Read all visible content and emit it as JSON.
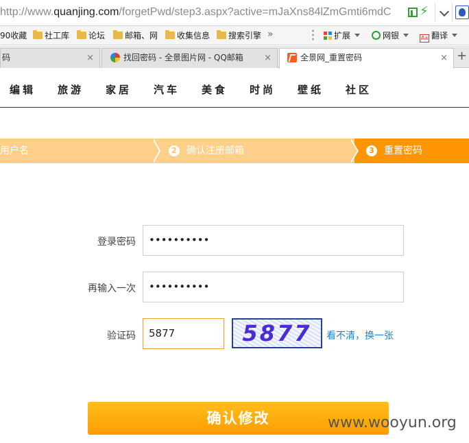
{
  "browser": {
    "url_prefix": "http://www.",
    "url_domain": "quanjing.com",
    "url_rest": "/forgetPwd/step3.aspx?active=mJaXns84lZmGmti6mdC",
    "bookmarks": [
      "90收藏",
      "社工库",
      "论坛",
      "邮箱、网",
      "收集信息",
      "搜索引擎"
    ],
    "more": "»",
    "ext_label": "扩展",
    "bank_label": "网银",
    "translate_label": "翻译",
    "translate_icon_text": "Aa",
    "tabs": [
      {
        "label": "码"
      },
      {
        "label": "找回密码 - 全景图片网 - QQ邮箱"
      },
      {
        "label": "全景网_重置密码"
      }
    ],
    "close": "×",
    "new_tab": "+"
  },
  "site": {
    "nav": [
      "编辑",
      "旅游",
      "家居",
      "汽车",
      "美食",
      "时尚",
      "壁纸",
      "社区"
    ]
  },
  "steps": [
    {
      "label": "用户名"
    },
    {
      "num": "2",
      "label": "确认注册邮箱"
    },
    {
      "num": "3",
      "label": "重置密码"
    }
  ],
  "form": {
    "password_label": "登录密码",
    "password_value": "••••••••••",
    "confirm_label": "再输入一次",
    "confirm_value": "••••••••••",
    "captcha_label": "验证码",
    "captcha_value": "5877",
    "captcha_image_text": "5877",
    "refresh_link": "看不清，换一张",
    "submit": "确认修改"
  },
  "watermark": "www.wooyun.org",
  "colors": {
    "step_light": "#ffd08a",
    "step_active": "#ff9500",
    "button": "#ffa800",
    "link": "#2a7fc0"
  }
}
